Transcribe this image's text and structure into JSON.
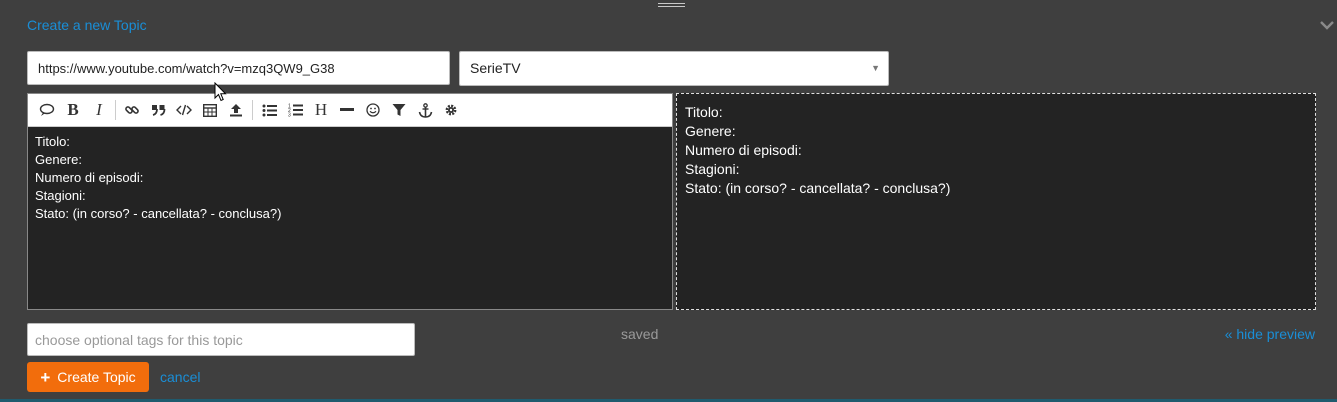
{
  "composer": {
    "title_link": "Create a new Topic",
    "collapse_icon": "chevron-down-icon"
  },
  "url_input": {
    "value": "https://www.youtube.com/watch?v=mzq3QW9_G38"
  },
  "category_select": {
    "selected": "SerieTV"
  },
  "toolbar": {
    "buttons": [
      "quote-icon",
      "bold-icon",
      "italic-icon",
      "link-icon",
      "blockquote-icon",
      "code-icon",
      "table-icon",
      "upload-icon",
      "bullet-list-icon",
      "numbered-list-icon",
      "heading-icon",
      "horizontal-rule-icon",
      "emoji-icon",
      "filter-icon",
      "anchor-icon",
      "gear-icon"
    ]
  },
  "editor": {
    "text": "Titolo:\nGenere:\nNumero di episodi:\nStagioni:\nStato: (in corso? - cancellata? - conclusa?)"
  },
  "preview": {
    "lines": [
      "Titolo:",
      "Genere:",
      "Numero di episodi:",
      "Stagioni:",
      "Stato: (in corso? - cancellata? - conclusa?)"
    ]
  },
  "tags_input": {
    "placeholder": "choose optional tags for this topic",
    "value": ""
  },
  "status": {
    "saved": "saved",
    "hide_preview": "« hide preview"
  },
  "actions": {
    "create_label": "Create Topic",
    "cancel_label": "cancel"
  },
  "colors": {
    "background": "#3f3f3f",
    "accent_link": "#1a8ed6",
    "primary_button": "#f26d0c",
    "editor_background": "#232323"
  }
}
